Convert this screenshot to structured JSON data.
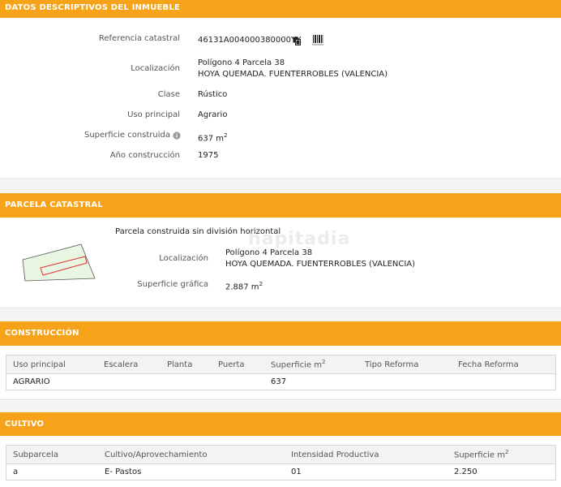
{
  "section1": {
    "title": "DATOS DESCRIPTIVOS DEL INMUEBLE",
    "ref_label": "Referencia catastral",
    "ref_value": "46131A004000380000YX",
    "loc_label": "Localización",
    "loc_line1": "Polígono 4 Parcela 38",
    "loc_line2": "HOYA QUEMADA. FUENTERROBLES (VALENCIA)",
    "clase_label": "Clase",
    "clase_value": "Rústico",
    "uso_label": "Uso principal",
    "uso_value": "Agrario",
    "sup_label": "Superficie construida",
    "sup_value": "637 m",
    "sup_unit_sup": "2",
    "anio_label": "Año construcción",
    "anio_value": "1975"
  },
  "section2": {
    "title": "PARCELA CATASTRAL",
    "subtitle": "Parcela construida sin división horizontal",
    "loc_label": "Localización",
    "loc_line1": "Polígono 4 Parcela 38",
    "loc_line2": "HOYA QUEMADA. FUENTERROBLES (VALENCIA)",
    "sup_label": "Superficie gráfica",
    "sup_value": "2.887 m",
    "sup_unit_sup": "2",
    "watermark": "hapitadia"
  },
  "section3": {
    "title": "CONSTRUCCIÓN",
    "headers": [
      "Uso principal",
      "Escalera",
      "Planta",
      "Puerta",
      "Superficie m",
      "Tipo Reforma",
      "Fecha Reforma"
    ],
    "sup_header_sup": "2",
    "row": [
      "AGRARIO",
      "",
      "",
      "",
      "637",
      "",
      ""
    ]
  },
  "section4": {
    "title": "CULTIVO",
    "headers": [
      "Subparcela",
      "Cultivo/Aprovechamiento",
      "Intensidad Productiva",
      "Superficie m"
    ],
    "sup_header_sup": "2",
    "row": [
      "a",
      "E- Pastos",
      "01",
      "2.250"
    ]
  },
  "colors": {
    "accent": "#f6a31a"
  },
  "icons": {
    "copy": "copy-icon",
    "barcode": "barcode-icon",
    "info": "info-icon"
  }
}
